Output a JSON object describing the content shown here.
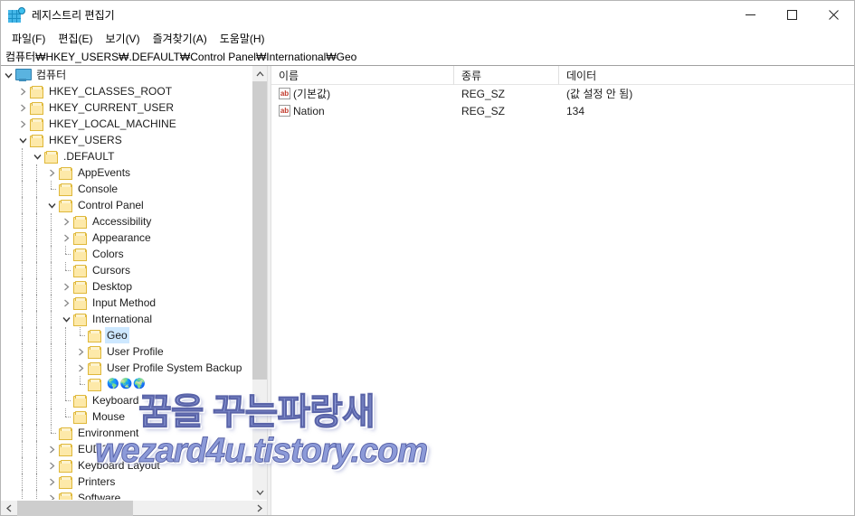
{
  "window": {
    "title": "레지스트리 편집기",
    "icon": "registry-editor-icon",
    "controls": {
      "minimize": "minimize-icon",
      "maximize": "maximize-icon",
      "close": "close-icon"
    }
  },
  "menubar": {
    "items": [
      {
        "label": "파일(F)"
      },
      {
        "label": "편집(E)"
      },
      {
        "label": "보기(V)"
      },
      {
        "label": "즐겨찾기(A)"
      },
      {
        "label": "도움말(H)"
      }
    ]
  },
  "addressbar": {
    "path": "컴퓨터₩HKEY_USERS₩.DEFAULT₩Control Panel₩International₩Geo"
  },
  "tree": {
    "nodes": [
      {
        "label": "컴퓨터",
        "level": 0,
        "twisty": "down",
        "icon": "computer-icon",
        "selected": false
      },
      {
        "label": "HKEY_CLASSES_ROOT",
        "level": 1,
        "twisty": "right",
        "icon": "folder-icon",
        "selected": false
      },
      {
        "label": "HKEY_CURRENT_USER",
        "level": 1,
        "twisty": "right",
        "icon": "folder-icon",
        "selected": false
      },
      {
        "label": "HKEY_LOCAL_MACHINE",
        "level": 1,
        "twisty": "right",
        "icon": "folder-icon",
        "selected": false
      },
      {
        "label": "HKEY_USERS",
        "level": 1,
        "twisty": "down",
        "icon": "folder-icon",
        "selected": false
      },
      {
        "label": ".DEFAULT",
        "level": 2,
        "twisty": "down",
        "icon": "folder-icon",
        "selected": false
      },
      {
        "label": "AppEvents",
        "level": 3,
        "twisty": "right",
        "icon": "folder-icon",
        "selected": false
      },
      {
        "label": "Console",
        "level": 3,
        "twisty": "none",
        "icon": "folder-icon",
        "selected": false
      },
      {
        "label": "Control Panel",
        "level": 3,
        "twisty": "down",
        "icon": "folder-icon",
        "selected": false
      },
      {
        "label": "Accessibility",
        "level": 4,
        "twisty": "right",
        "icon": "folder-icon",
        "selected": false
      },
      {
        "label": "Appearance",
        "level": 4,
        "twisty": "right",
        "icon": "folder-icon",
        "selected": false
      },
      {
        "label": "Colors",
        "level": 4,
        "twisty": "none",
        "icon": "folder-icon",
        "selected": false
      },
      {
        "label": "Cursors",
        "level": 4,
        "twisty": "none",
        "icon": "folder-icon",
        "selected": false
      },
      {
        "label": "Desktop",
        "level": 4,
        "twisty": "right",
        "icon": "folder-icon",
        "selected": false
      },
      {
        "label": "Input Method",
        "level": 4,
        "twisty": "right",
        "icon": "folder-icon",
        "selected": false
      },
      {
        "label": "International",
        "level": 4,
        "twisty": "down",
        "icon": "folder-icon",
        "selected": false
      },
      {
        "label": "Geo",
        "level": 5,
        "twisty": "none",
        "icon": "folder-icon",
        "selected": true
      },
      {
        "label": "User Profile",
        "level": 5,
        "twisty": "right",
        "icon": "folder-icon",
        "selected": false
      },
      {
        "label": "User Profile System Backup",
        "level": 5,
        "twisty": "right",
        "icon": "folder-icon",
        "selected": false
      },
      {
        "label": "🌎🌏🌍",
        "level": 5,
        "twisty": "none",
        "icon": "folder-icon",
        "selected": false
      },
      {
        "label": "Keyboard",
        "level": 4,
        "twisty": "none",
        "icon": "folder-icon",
        "selected": false
      },
      {
        "label": "Mouse",
        "level": 4,
        "twisty": "none",
        "icon": "folder-icon",
        "selected": false
      },
      {
        "label": "Environment",
        "level": 3,
        "twisty": "none",
        "icon": "folder-icon",
        "selected": false
      },
      {
        "label": "EUDC",
        "level": 3,
        "twisty": "right",
        "icon": "folder-icon",
        "selected": false
      },
      {
        "label": "Keyboard Layout",
        "level": 3,
        "twisty": "right",
        "icon": "folder-icon",
        "selected": false
      },
      {
        "label": "Printers",
        "level": 3,
        "twisty": "right",
        "icon": "folder-icon",
        "selected": false
      },
      {
        "label": "Software",
        "level": 3,
        "twisty": "right",
        "icon": "folder-icon",
        "selected": false
      }
    ]
  },
  "list": {
    "columns": [
      {
        "label": "이름"
      },
      {
        "label": "종류"
      },
      {
        "label": "데이터"
      }
    ],
    "rows": [
      {
        "name": "(기본값)",
        "icon": "string-value-icon",
        "type": "REG_SZ",
        "data": "(값 설정 안 됨)"
      },
      {
        "name": "Nation",
        "icon": "string-value-icon",
        "type": "REG_SZ",
        "data": "134"
      }
    ]
  },
  "watermark": {
    "line1": "꿈을 꾸는파랑새",
    "line2": "wezard4u.tistory.com"
  }
}
